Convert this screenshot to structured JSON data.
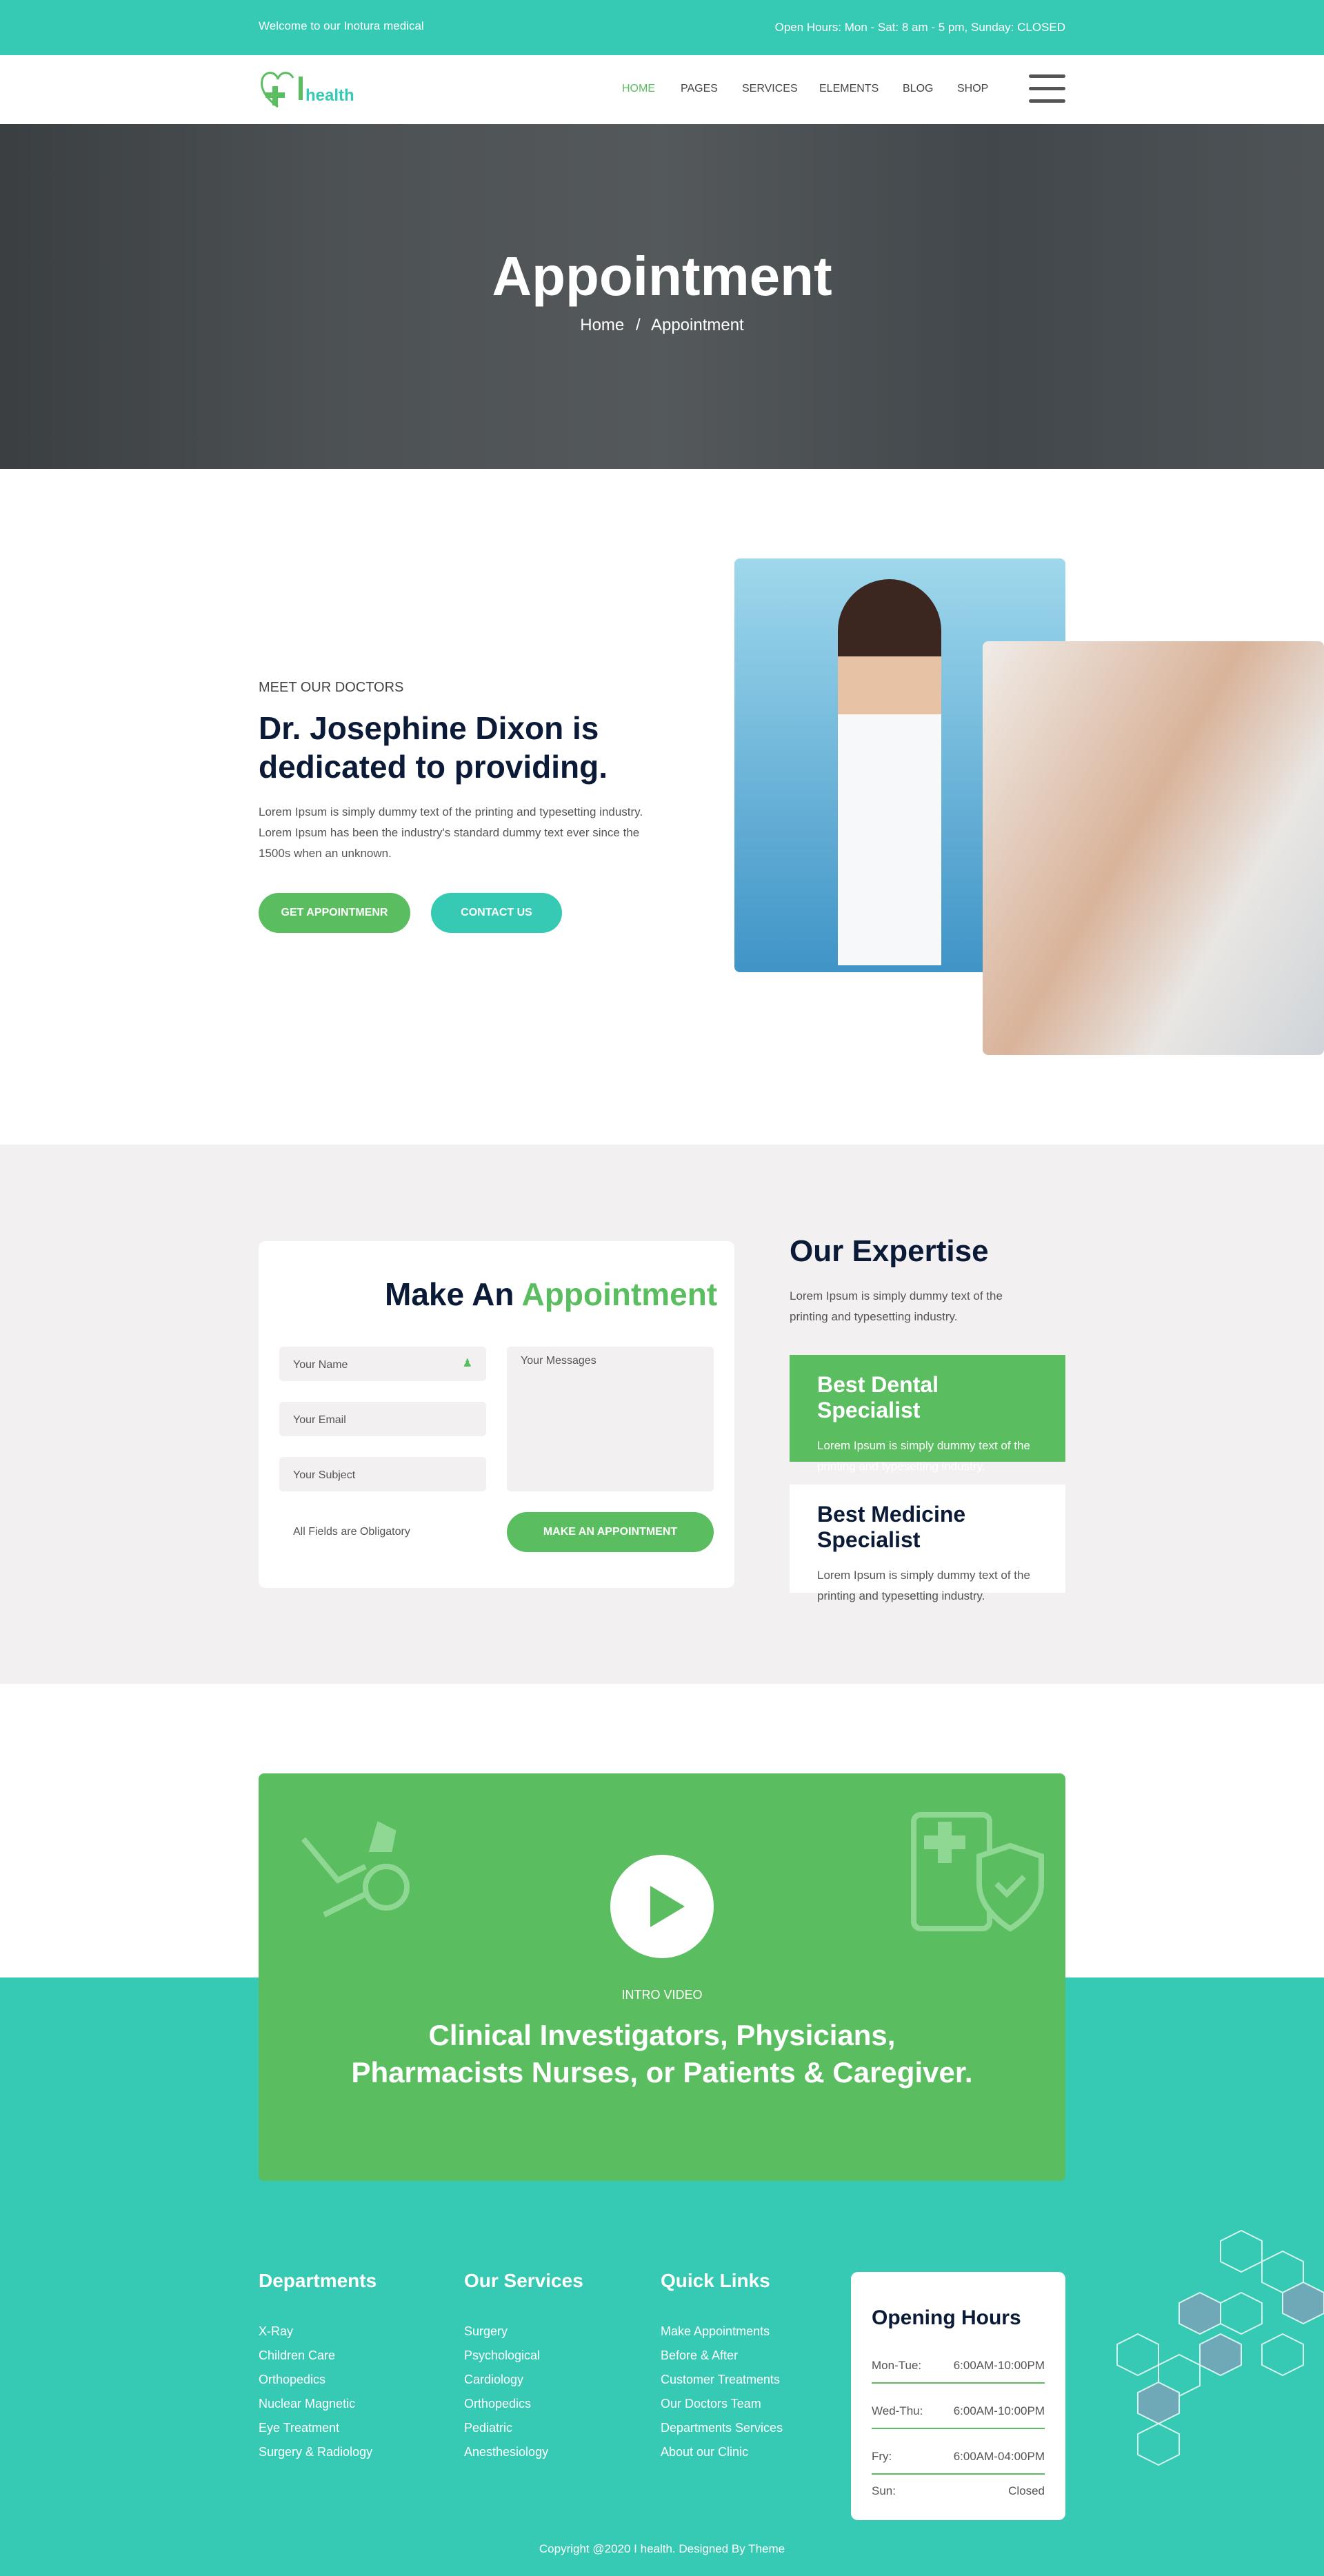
{
  "topbar": {
    "welcome": "Welcome to our Inotura medical",
    "hours": "Open Hours: Mon - Sat: 8 am - 5 pm, Sunday: CLOSED"
  },
  "nav": {
    "logo_text": "health",
    "items": [
      "HOME",
      "PAGES",
      "SERVICES",
      "ELEMENTS",
      "BLOG",
      "SHOP"
    ],
    "active": "HOME"
  },
  "hero": {
    "title": "Appointment",
    "breadcrumb": [
      "Home",
      "Appointment"
    ],
    "separator": "/"
  },
  "about": {
    "kicker": "MEET OUR DOCTORS",
    "heading": "Dr. Josephine Dixon is dedicated to providing.",
    "text": "Lorem Ipsum is simply dummy text of the printing and typesetting industry. Lorem Ipsum has been the industry's standard dummy text ever since the 1500s when an unknown.",
    "btn_primary": "GET APPOINTMENR",
    "btn_secondary": "CONTACT US"
  },
  "form": {
    "title_a": "Make An",
    "title_b": "Appointment",
    "name_placeholder": "Your Name",
    "email_placeholder": "Your Email",
    "subject_placeholder": "Your Subject",
    "message_placeholder": "Your Messages",
    "note": "All Fields are Obligatory",
    "submit": "MAKE AN APPOINTMENT"
  },
  "expertise": {
    "title": "Our Expertise",
    "text": "Lorem Ipsum is simply dummy text of the printing and typesetting industry.",
    "cards": [
      {
        "title": "Best Dental Specialist",
        "text": "Lorem Ipsum is simply dummy text of the printing and typesetting industry."
      },
      {
        "title": "Best Medicine Specialist",
        "text": "Lorem Ipsum is simply dummy text of the printing and typesetting industry."
      }
    ]
  },
  "video": {
    "label": "INTRO VIDEO",
    "headline_1": "Clinical Investigators, Physicians,",
    "headline_2": "Pharmacists Nurses, or Patients & Caregiver."
  },
  "footer": {
    "departments": {
      "title": "Departments",
      "items": [
        "X-Ray",
        "Children Care",
        "Orthopedics",
        "Nuclear Magnetic",
        "Eye Treatment",
        "Surgery & Radiology"
      ]
    },
    "services": {
      "title": "Our Services",
      "items": [
        "Surgery",
        "Psychological",
        "Cardiology",
        "Orthopedics",
        "Pediatric",
        "Anesthesiology"
      ]
    },
    "links": {
      "title": "Quick Links",
      "items": [
        "Make Appointments",
        "Before & After",
        "Customer Treatments",
        "Our Doctors Team",
        "Departments Services",
        "About our Clinic"
      ]
    },
    "hours": {
      "title": "Opening Hours",
      "rows": [
        {
          "day": "Mon-Tue:",
          "time": "6:00AM-10:00PM"
        },
        {
          "day": "Wed-Thu:",
          "time": "6:00AM-10:00PM"
        },
        {
          "day": "Fry:",
          "time": "6:00AM-04:00PM"
        },
        {
          "day": "Sun:",
          "time": "Closed"
        }
      ]
    },
    "copyright": "Copyright @2020 I health. Designed By Theme"
  },
  "colors": {
    "teal": "#36c9b4",
    "green": "#5abd5f",
    "navy": "#0b1a36",
    "light_bg": "#f2f0f1"
  }
}
